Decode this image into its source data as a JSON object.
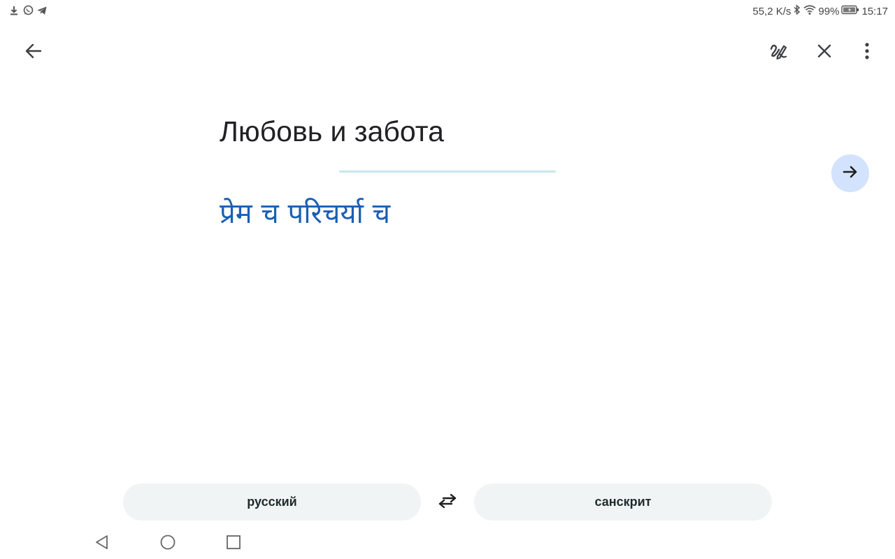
{
  "status_bar": {
    "left_icons": [
      "download-icon",
      "whatsapp-icon",
      "telegram-icon"
    ],
    "net_speed": "55,2 K/s",
    "battery": "99%",
    "time": "15:17"
  },
  "toolbar": {
    "icons": [
      "back-arrow-icon",
      "handwriting-icon",
      "close-icon",
      "more-vert-icon"
    ]
  },
  "translate": {
    "source_text": "Любовь и забота",
    "translation": "प्रेम च परिचर्या च",
    "go_icon": "arrow-forward-icon"
  },
  "languages": {
    "source": "русский",
    "target": "санскрит",
    "swap_icon": "swap-arrows-icon"
  },
  "nav_bar": {
    "icons": [
      "nav-back-icon",
      "nav-home-icon",
      "nav-recents-icon"
    ]
  },
  "colors": {
    "translation_text": "#1a5fb4",
    "go_button_bg": "#d3e3fd",
    "divider": "#c9e6ee",
    "pill_bg": "#f1f4f4"
  }
}
